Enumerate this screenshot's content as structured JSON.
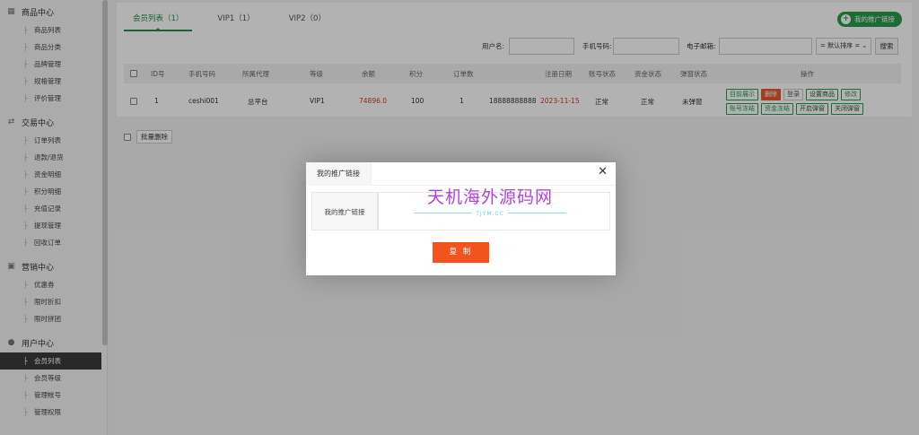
{
  "sidebar": {
    "groups": [
      {
        "title": "商品中心",
        "items": [
          "商品列表",
          "商品分类",
          "品牌管理",
          "规格管理",
          "评价管理"
        ]
      },
      {
        "title": "交易中心",
        "items": [
          "订单列表",
          "退款/退货",
          "资金明细",
          "积分明细",
          "充值记录",
          "提现管理",
          "回收订单"
        ]
      },
      {
        "title": "营销中心",
        "items": [
          "优惠券",
          "限时折扣",
          "限时拼团"
        ]
      },
      {
        "title": "用户中心",
        "items": [
          "会员列表",
          "会员等级",
          "管理帐号",
          "管理权限"
        ]
      }
    ],
    "active_item": "会员列表"
  },
  "tabs": [
    "会员列表（1）",
    "VIP1（1）",
    "VIP2（0）"
  ],
  "promo_button": "我的推广链接",
  "filters": {
    "username_label": "用户名:",
    "phone_label": "手机号码:",
    "email_label": "电子邮箱:",
    "sort_value": "= 默认排序 =",
    "search_label": "搜索"
  },
  "table": {
    "headers": [
      "ID号",
      "手机号码",
      "所属代理",
      "等级",
      "余额",
      "积分",
      "订单数",
      "注册日期",
      "账号状态",
      "资金状态",
      "弹窗状态",
      "操作"
    ],
    "rows": [
      {
        "id": "1",
        "phone": "ceshi001",
        "agent": "总平台",
        "level": "VIP1",
        "balance": "74896.0",
        "points": "100",
        "orders": "1",
        "extra_phone": "18888888888",
        "reg_date": "2023-11-15",
        "account_status": "正常",
        "fund_status": "正常",
        "popup_status": "未弹窗",
        "ops_line1": [
          "目前展示",
          "删除",
          "登录",
          "设置商品",
          "修改"
        ],
        "ops_line2": [
          "账号冻结",
          "资金冻结",
          "开启弹窗",
          "关闭弹窗"
        ]
      }
    ]
  },
  "batch_delete": "批量删除",
  "modal": {
    "title": "我的推广链接",
    "link_label": "我的推广链接",
    "copy_button": "复 制",
    "watermark_main": "天机海外源码网",
    "watermark_sub": "TJYM.CC"
  },
  "colors": {
    "accent": "#2a9b4e",
    "danger": "#e55a2b",
    "copy": "#f2541f",
    "watermark": "#b341d8"
  },
  "icons": {
    "close": "close-icon",
    "plus": "plus-icon"
  }
}
